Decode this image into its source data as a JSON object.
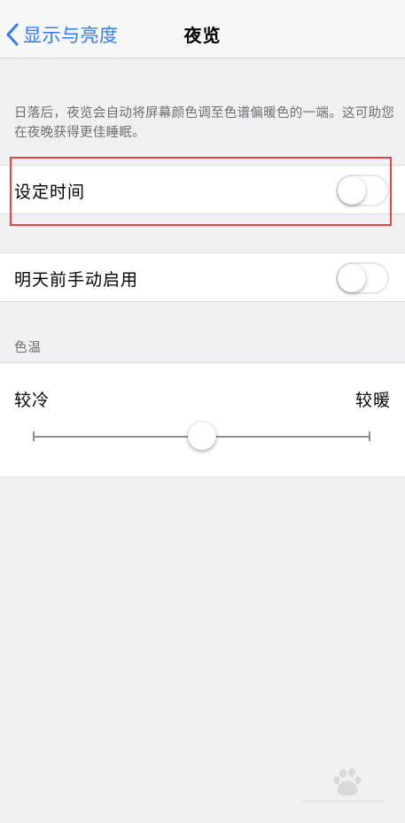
{
  "nav": {
    "back_label": "显示与亮度",
    "title": "夜览"
  },
  "description": "日落后，夜览会自动将屏幕颜色调至色谱偏暖色的一端。这可助您在夜晚获得更佳睡眠。",
  "scheduled": {
    "label": "设定时间",
    "enabled": false
  },
  "manual": {
    "label": "明天前手动启用",
    "enabled": false
  },
  "color_temperature": {
    "header": "色温",
    "min_label": "较冷",
    "max_label": "较暖",
    "value": 0.5
  },
  "colors": {
    "accent": "#2f7bf6",
    "highlight": "#e7443d",
    "background": "#efeff4"
  }
}
